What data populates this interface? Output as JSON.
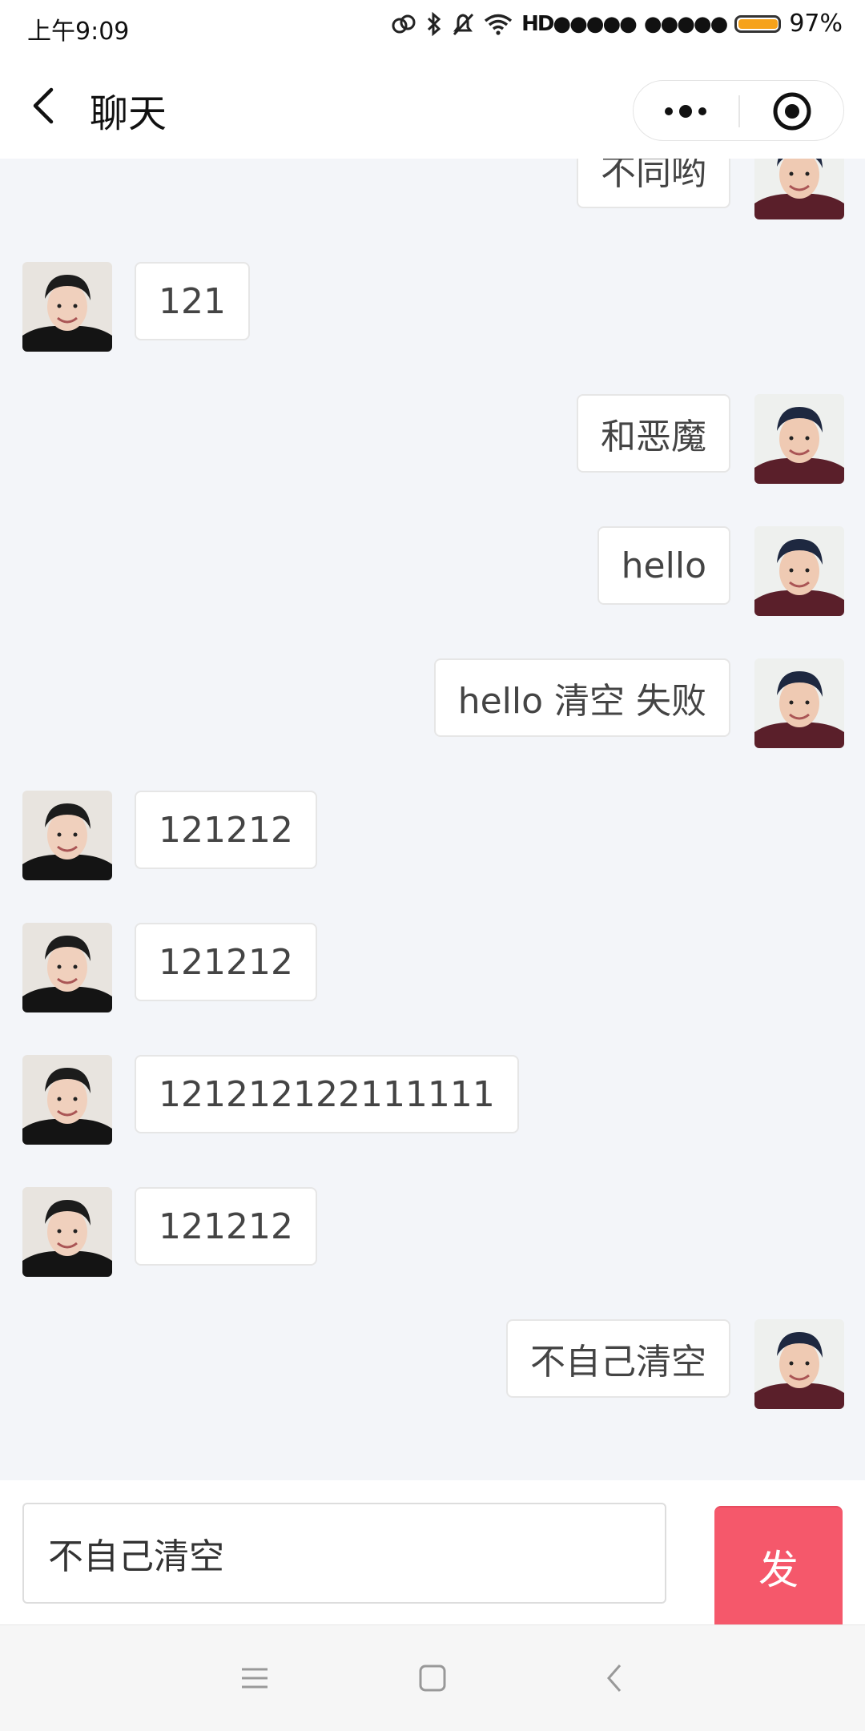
{
  "status_bar": {
    "time": "上午9:09",
    "signal_1": "HD●●●●●",
    "signal_2": "●●●●●",
    "battery_percent": "97%",
    "battery_level": 0.97,
    "icons": [
      "link-icon",
      "bluetooth-icon",
      "mute-icon",
      "wifi-icon"
    ]
  },
  "nav": {
    "title": "聊天",
    "back_icon": "back-arrow-icon",
    "more_icon": "more-dots-icon",
    "close_icon": "target-close-icon"
  },
  "messages": [
    {
      "side": "right",
      "text": "不同哟"
    },
    {
      "side": "left",
      "text": "121"
    },
    {
      "side": "right",
      "text": "和恶魔"
    },
    {
      "side": "right",
      "text": "hello"
    },
    {
      "side": "right",
      "text": "hello 清空 失败"
    },
    {
      "side": "left",
      "text": "121212"
    },
    {
      "side": "left",
      "text": "121212"
    },
    {
      "side": "left",
      "text": "121212122111111"
    },
    {
      "side": "left",
      "text": "121212"
    },
    {
      "side": "right",
      "text": "不自己清空"
    }
  ],
  "input": {
    "value": "不自己清空",
    "send_label": "发"
  },
  "system_nav": [
    "menu-icon",
    "home-icon",
    "back-icon"
  ],
  "colors": {
    "send_button": "#f5586b",
    "chat_background": "#f3f5f9",
    "battery": "#f6a21a"
  }
}
